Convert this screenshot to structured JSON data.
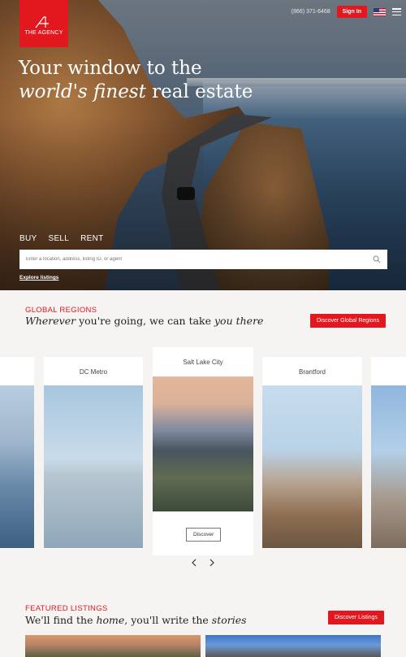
{
  "brand": {
    "logo_text": "THE AGENCY",
    "accent": "#e3171e"
  },
  "header": {
    "phone": "(866) 371-6468",
    "signin_label": "Sign In",
    "locale_icon": "us-flag-icon",
    "menu_icon": "hamburger-icon"
  },
  "hero": {
    "headline_line1": "Your window to the",
    "headline_italic": "world's finest",
    "headline_rest": " real estate",
    "tabs": [
      "BUY",
      "SELL",
      "RENT"
    ],
    "search_placeholder": "Enter a location, address, listing ID, or agent",
    "explore_label": "Explore listings"
  },
  "regions": {
    "eyebrow": "GLOBAL REGIONS",
    "title_pre": "Wherever",
    "title_mid": " you're going, we can take ",
    "title_italic": "you there",
    "button_label": "Discover Global Regions",
    "cards": [
      {
        "name": "DC Metro"
      },
      {
        "name": "Salt Lake City",
        "button_label": "Discover"
      },
      {
        "name": "Brantford"
      }
    ]
  },
  "featured": {
    "eyebrow": "FEATURED LISTINGS",
    "title_pre": "We'll find the ",
    "title_italic1": "home",
    "title_mid": ", you'll write the ",
    "title_italic2": "stories",
    "button_label": "Discover Listings"
  }
}
